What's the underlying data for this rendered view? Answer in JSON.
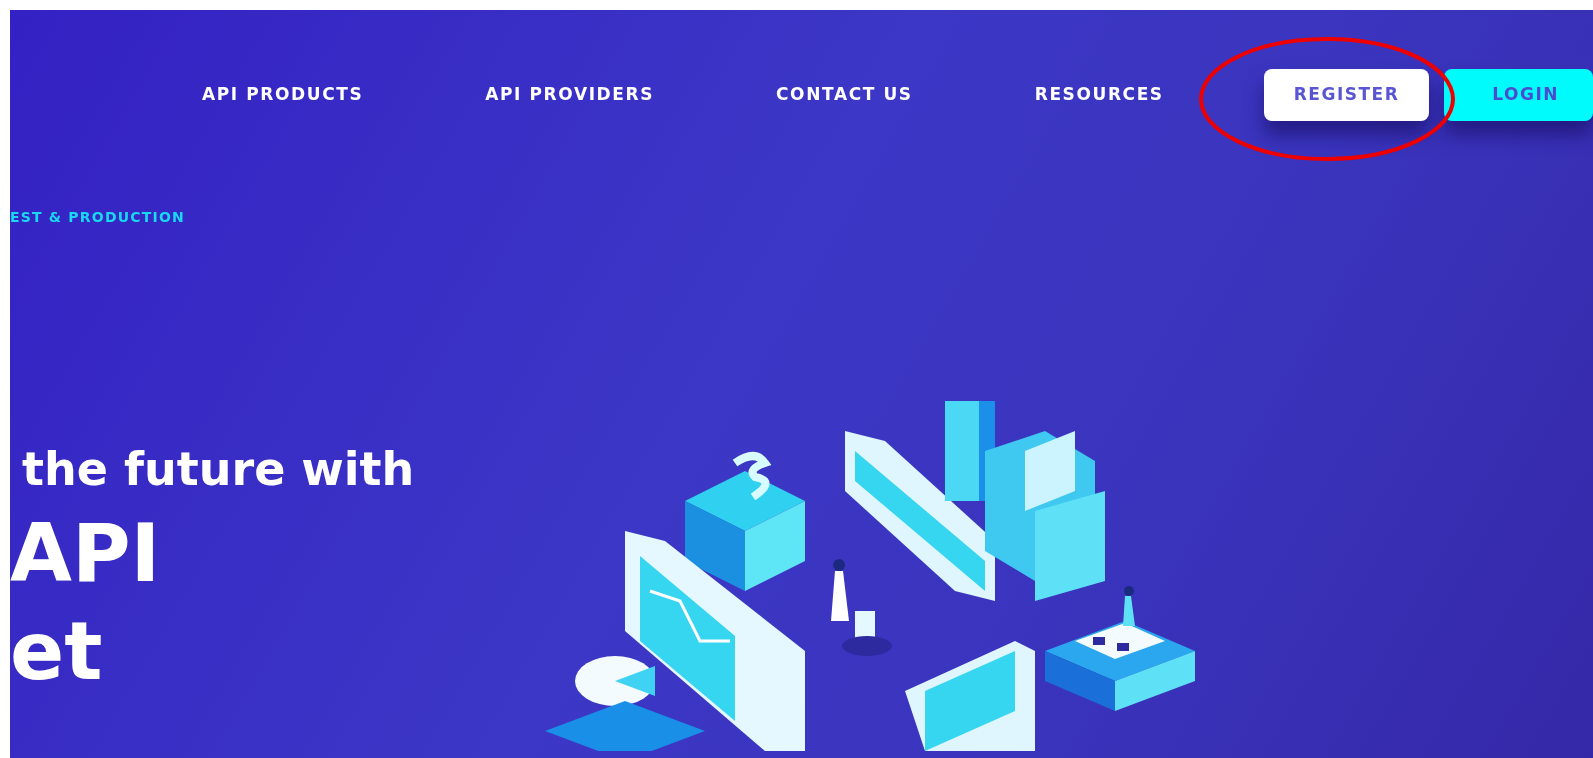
{
  "nav": {
    "items": [
      {
        "label": "API PRODUCTS"
      },
      {
        "label": "API PROVIDERS"
      },
      {
        "label": "CONTACT US"
      },
      {
        "label": "RESOURCES"
      }
    ],
    "buttons": [
      {
        "label": "REGISTER",
        "kind": "outline"
      },
      {
        "label": "LOGIN",
        "kind": "accent"
      }
    ]
  },
  "hero": {
    "tagline": "EST & PRODUCTION",
    "headline": [
      "the future with",
      "API",
      "et"
    ]
  }
}
